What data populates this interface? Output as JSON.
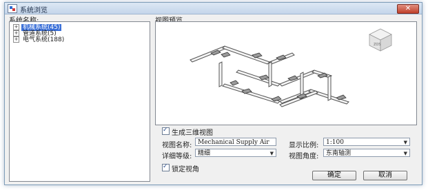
{
  "window": {
    "title": "系统浏览",
    "close_label": "✕"
  },
  "tree": {
    "header": "系统名称:",
    "items": [
      {
        "expander": "+",
        "label": "机械系统(45)",
        "selected": true
      },
      {
        "expander": "+",
        "label": "管道系统(5)",
        "selected": false
      },
      {
        "expander": "+",
        "label": "电气系统(188)",
        "selected": false
      }
    ]
  },
  "preview": {
    "header": "视图预览",
    "navcube_label": "ZOS"
  },
  "options": {
    "generate_3d": {
      "label": "生成三维视图",
      "checked": true
    },
    "view_name": {
      "label": "视图名称:",
      "value": "Mechanical Supply Air"
    },
    "scale": {
      "label": "显示比例:",
      "value": "1:100"
    },
    "detail_level": {
      "label": "详细等级:",
      "value": "精细"
    },
    "view_angle": {
      "label": "视图角度:",
      "value": "东南轴测"
    },
    "lock_view": {
      "label": "锁定视角",
      "checked": true
    }
  },
  "buttons": {
    "ok": "确定",
    "cancel": "取消"
  },
  "colors": {
    "selection": "#3a6fd8",
    "close_button": "#c0402a"
  }
}
